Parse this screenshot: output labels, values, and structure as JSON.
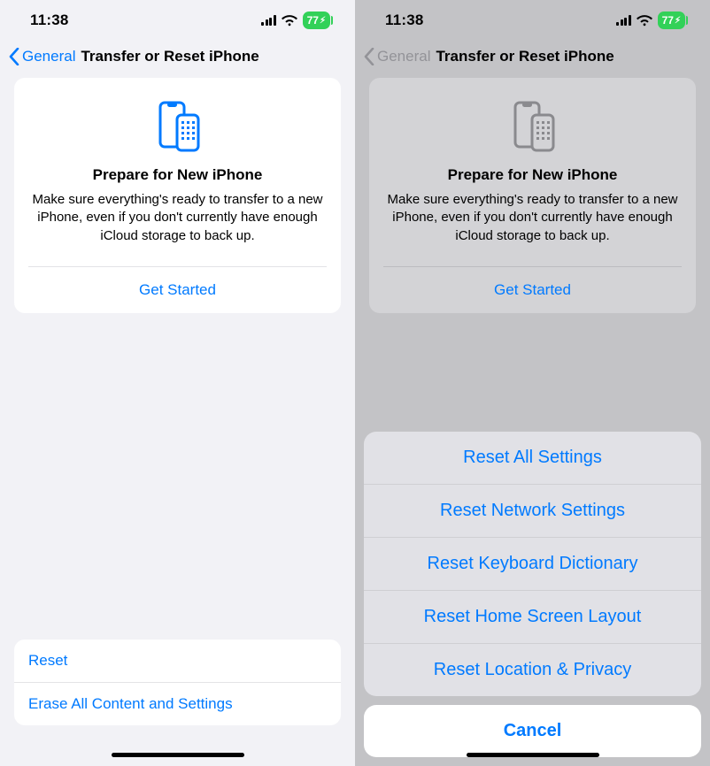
{
  "status": {
    "time": "11:38",
    "battery": "77"
  },
  "nav": {
    "back": "General",
    "title": "Transfer or Reset iPhone"
  },
  "card": {
    "title": "Prepare for New iPhone",
    "desc": "Make sure everything's ready to transfer to a new iPhone, even if you don't currently have enough iCloud storage to back up.",
    "button": "Get Started"
  },
  "bottom": {
    "reset": "Reset",
    "erase": "Erase All Content and Settings"
  },
  "sheet": {
    "items": [
      "Reset All Settings",
      "Reset Network Settings",
      "Reset Keyboard Dictionary",
      "Reset Home Screen Layout",
      "Reset Location & Privacy"
    ],
    "cancel": "Cancel"
  },
  "iconColors": {
    "active": "#007aff",
    "dimmed": "#8a8a8e"
  }
}
